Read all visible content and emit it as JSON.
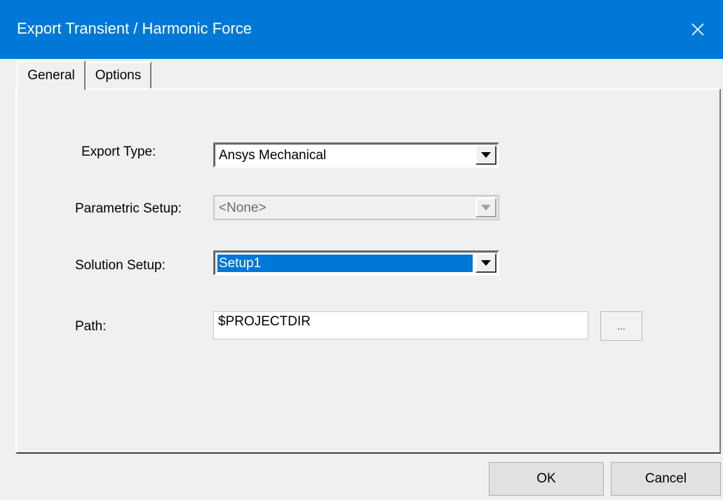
{
  "dialog": {
    "title": "Export Transient / Harmonic Force",
    "close_icon": "close-icon"
  },
  "tabs": [
    {
      "label": "General",
      "active": true
    },
    {
      "label": "Options",
      "active": false
    }
  ],
  "form": {
    "export_type": {
      "label": "Export Type:",
      "value": "Ansys Mechanical"
    },
    "parametric_setup": {
      "label": "Parametric Setup:",
      "value": "<None>",
      "disabled": true
    },
    "solution_setup": {
      "label": "Solution Setup:",
      "value": "Setup1"
    },
    "path": {
      "label": "Path:",
      "value": "$PROJECTDIR",
      "browse_label": "..."
    }
  },
  "buttons": {
    "ok": "OK",
    "cancel": "Cancel"
  },
  "colors": {
    "titlebar": "#0078d7",
    "selection": "#0078d7"
  }
}
